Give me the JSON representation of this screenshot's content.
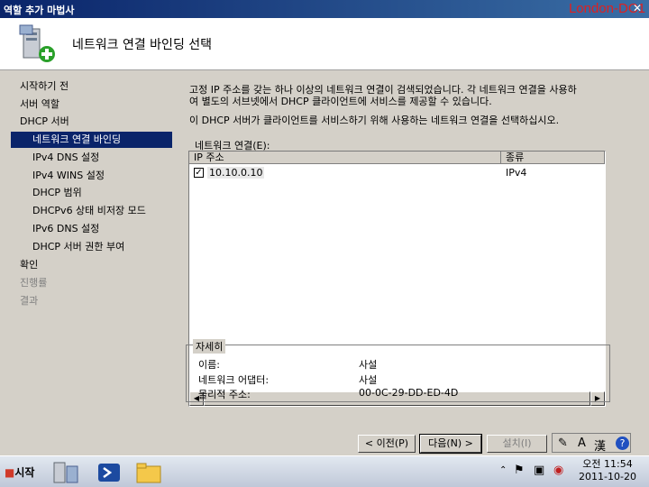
{
  "window": {
    "title": "역할 추가 마법사",
    "server_label": "London-DC1",
    "close": "✕"
  },
  "header": {
    "heading": "네트워크 연결 바인딩 선택"
  },
  "nav": {
    "items": [
      {
        "label": "시작하기 전"
      },
      {
        "label": "서버 역할"
      },
      {
        "label": "DHCP 서버"
      },
      {
        "label": "네트워크 연결 바인딩"
      },
      {
        "label": "IPv4 DNS 설정"
      },
      {
        "label": "IPv4 WINS 설정"
      },
      {
        "label": "DHCP 범위"
      },
      {
        "label": "DHCPv6 상태 비저장 모드"
      },
      {
        "label": "IPv6 DNS 설정"
      },
      {
        "label": "DHCP 서버 권한 부여"
      },
      {
        "label": "확인"
      },
      {
        "label": "진행률"
      },
      {
        "label": "결과"
      }
    ]
  },
  "content": {
    "description_line1": "고정 IP 주소를 갖는 하나 이상의 네트워크 연결이 검색되었습니다. 각 네트워크 연결을 사용하",
    "description_line2": "여 별도의 서브넷에서 DHCP 클라이언트에 서비스를 제공할 수 있습니다.",
    "description_3": "이 DHCP 서버가 클라이언트를 서비스하기 위해 사용하는 네트워크 연결을 선택하십시오.",
    "list_label": "네트워크 연결(E):",
    "columns": [
      "IP 주소",
      "종류"
    ],
    "rows": [
      {
        "checked": true,
        "ip": "10.10.0.10",
        "type": "IPv4"
      }
    ],
    "check_mark": "✓",
    "details": {
      "title": "자세히",
      "rows": [
        {
          "label": "이름:",
          "value": "사설"
        },
        {
          "label": "네트워크 어댑터:",
          "value": "사설"
        },
        {
          "label": "물리적 주소:",
          "value": "00-0C-29-DD-ED-4D"
        }
      ]
    }
  },
  "buttons": {
    "prev": "< 이전(P)",
    "next": "다음(N) >",
    "install": "설치(I)"
  },
  "language_bar": {
    "mode": "A",
    "hanja": "漢",
    "help": "?"
  },
  "taskbar": {
    "start_label": "시작"
  },
  "clock": {
    "time": "오전 11:54",
    "date": "2011-10-20"
  },
  "colors": {
    "title_bar": "#0a246a",
    "selection": "#0a246a",
    "server_label": "#e02020"
  }
}
